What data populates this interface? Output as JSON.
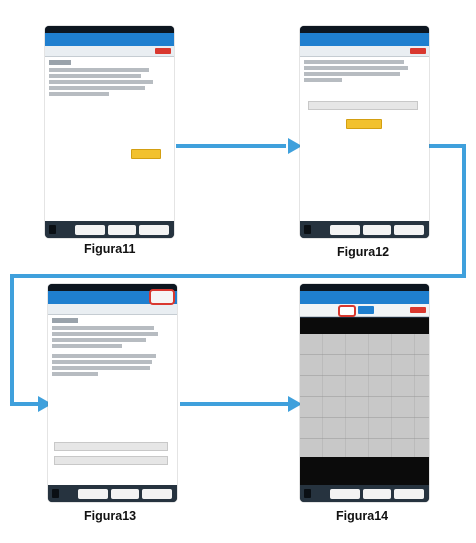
{
  "captions": {
    "fig11": "Figura11",
    "fig12": "Figura12",
    "fig13": "Figura13",
    "fig14": "Figura14"
  },
  "colors": {
    "flow_arrow": "#3fa0dc",
    "titlebar": "#1f7fcf",
    "accent_button": "#f2c12e",
    "close_button": "#d9382f"
  },
  "icons": [
    "arrow-right-icon",
    "close-icon"
  ]
}
